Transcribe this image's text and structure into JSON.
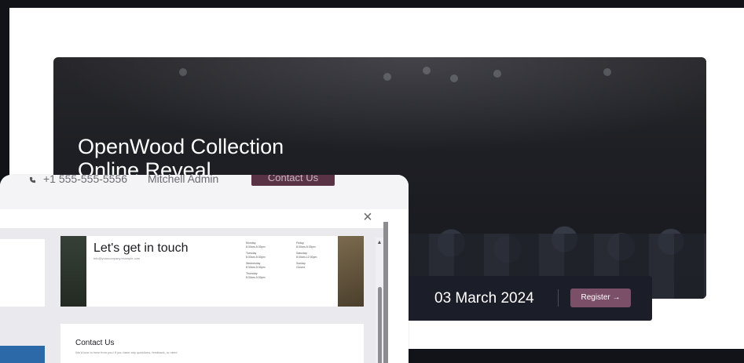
{
  "hero": {
    "title_line1": "OpenWood Collection",
    "title_line2": "Online Reveal",
    "date": "03 March 2024",
    "register_label": "Register →"
  },
  "header_strip": {
    "phone": "+1 555-555-5556",
    "user": "Mitchell Admin",
    "contact_button": "Contact Us"
  },
  "modal": {
    "close_glyph": "×",
    "get_in_touch_title": "Let's get in touch",
    "get_in_touch_email": "info@yourcompany.example.com",
    "hours": [
      {
        "day": "Monday",
        "time": "8:30am-5:30pm"
      },
      {
        "day": "Tuesday",
        "time": "8:30am-5:30pm"
      },
      {
        "day": "Wednesday",
        "time": "8:30am-5:30pm"
      },
      {
        "day": "Thursday",
        "time": "8:30am-5:30pm"
      },
      {
        "day": "Friday",
        "time": "8:30am-5:30pm"
      },
      {
        "day": "Saturday",
        "time": "8:30am-12:30pm"
      },
      {
        "day": "Sunday",
        "time": "Closed"
      }
    ],
    "contact_us_title": "Contact Us",
    "contact_us_text": "We'd love to hear from you! If you have any questions, feedback, or need"
  },
  "icons": {
    "phone": "phone-icon",
    "close": "close-icon",
    "scroll_up": "chevron-up-icon"
  },
  "colors": {
    "accent": "#7b4f68",
    "contact_pill": "#5a3245",
    "hero_bg": "#1e1f24",
    "register_bar": "#1b1d29"
  }
}
